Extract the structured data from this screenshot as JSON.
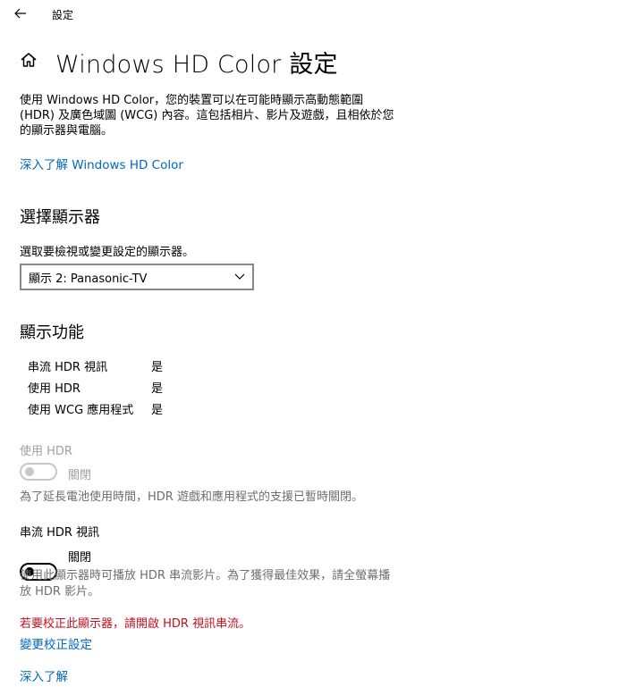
{
  "titlebar": {
    "title": "設定"
  },
  "header": {
    "title": "Windows HD Color 設定"
  },
  "intro": {
    "description": "使用 Windows HD Color，您的裝置可以在可能時顯示高動態範圍 (HDR) 及廣色域圖 (WCG) 內容。這包括相片、影片及遊戲，且相依於您的顯示器與電腦。",
    "learn_more_link": "深入了解 Windows HD Color"
  },
  "choose_display": {
    "heading": "選擇顯示器",
    "label": "選取要檢視或變更設定的顯示器。",
    "selected": "顯示 2: Panasonic-TV"
  },
  "display_capabilities": {
    "heading": "顯示功能",
    "rows": [
      {
        "name": "串流 HDR 視訊",
        "value": "是"
      },
      {
        "name": "使用 HDR",
        "value": "是"
      },
      {
        "name": "使用 WCG 應用程式",
        "value": "是"
      }
    ]
  },
  "use_hdr": {
    "label": "使用 HDR",
    "state": "關閉",
    "note": "為了延長電池使用時間，HDR 遊戲和應用程式的支援已暫時關閉。"
  },
  "stream_hdr": {
    "label": "串流 HDR 視訊",
    "state": "關閉",
    "note": "使用此顯示器時可播放 HDR 串流影片。為了獲得最佳效果，請全螢幕播放 HDR 影片。",
    "warning": "若要校正此顯示器，請開啟 HDR 視訊串流。",
    "calibrate_link": "變更校正設定"
  },
  "footer": {
    "learn_more_link": "深入了解"
  },
  "colors": {
    "link": "#0067c0",
    "warning": "#c50f1f",
    "disabled": "#a0a0a0"
  }
}
